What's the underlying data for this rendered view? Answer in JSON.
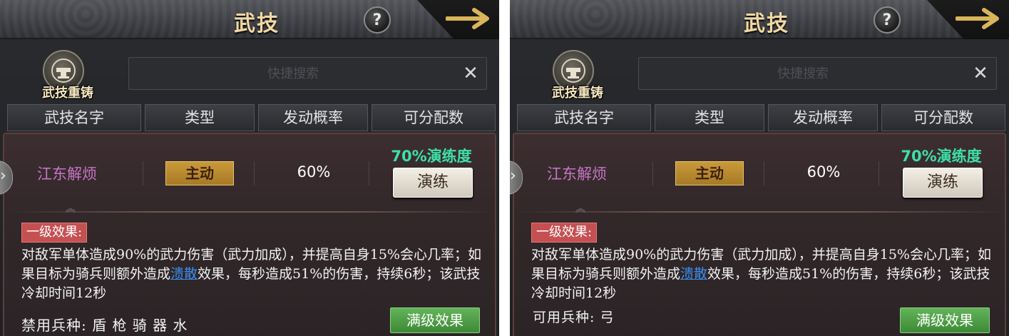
{
  "header": {
    "title": "武技",
    "help_symbol": "?"
  },
  "reforge": {
    "label": "武技重铸",
    "icon": "anvil-icon"
  },
  "search": {
    "placeholder": "快捷搜索",
    "clear_symbol": "✕"
  },
  "columns": [
    "武技名字",
    "类型",
    "发动概率",
    "可分配数"
  ],
  "skill": {
    "name": "江东解烦",
    "type": "主动",
    "rate": "60%",
    "drill_progress": "70%演练度",
    "drill_button": "演练"
  },
  "effect": {
    "tag": "一级效果:",
    "desc_before": "对敌军单体造成90%的武力伤害（武力加成），并提高自身15%会心几率；如果目标为骑兵则额外造成",
    "desc_highlight": "溃散",
    "desc_after": "效果，每秒造成51%的伤害，持续6秒；该武技冷却时间12秒"
  },
  "left": {
    "units_line": "禁用兵种:  盾 枪 骑 器 水"
  },
  "right": {
    "units_line": "可用兵种:  弓"
  },
  "max_button": "满级效果",
  "colors": {
    "skill_name": "#c775c6",
    "drill_progress": "#3de0a9",
    "type_badge": "#b78a30",
    "effect_tag": "#c55052",
    "highlight": "#3a8ef0",
    "max_button": "#4f9f47"
  }
}
